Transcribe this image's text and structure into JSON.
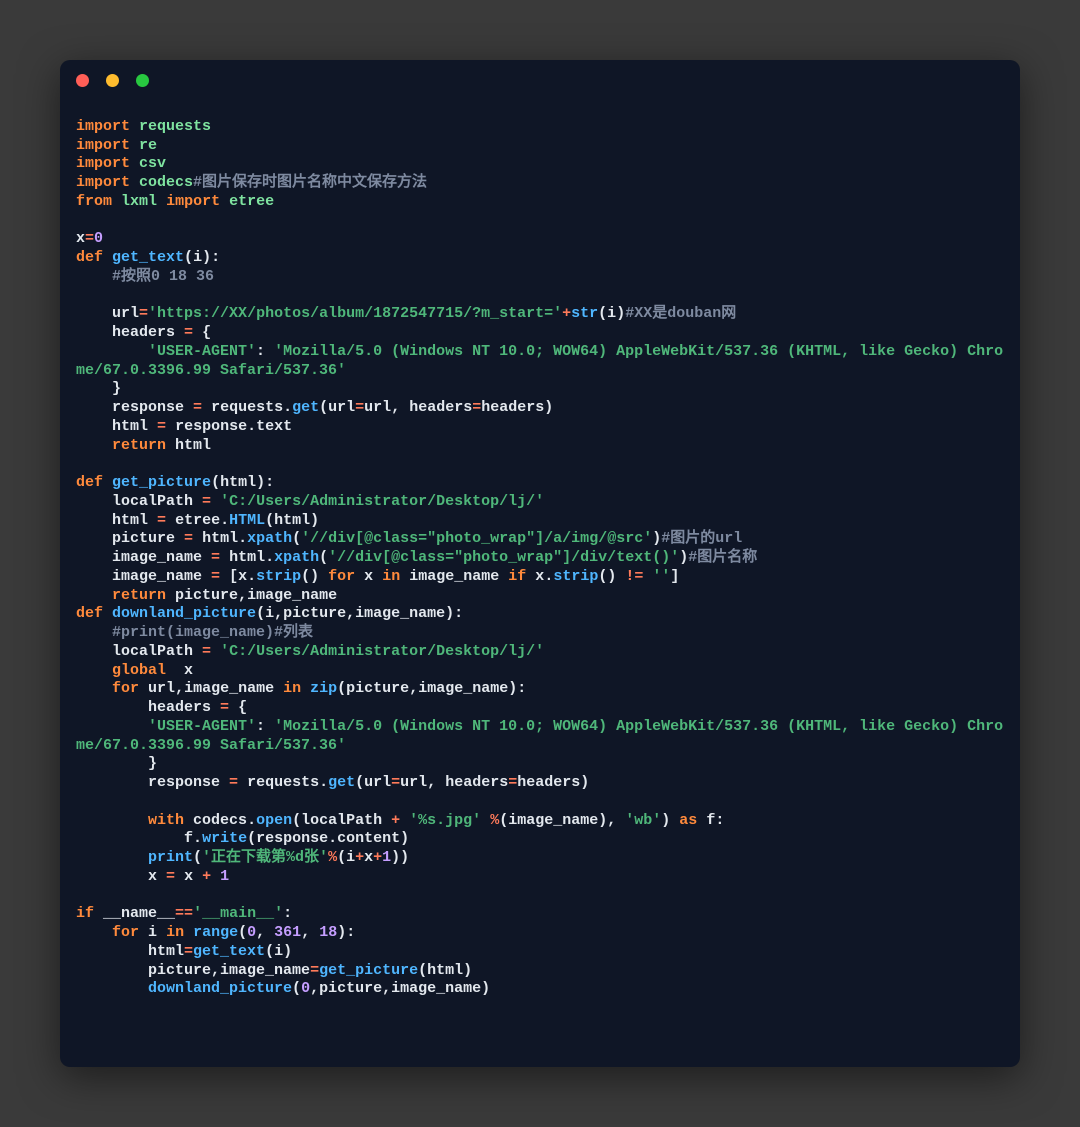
{
  "window": {
    "traffic": [
      "close",
      "minimize",
      "zoom"
    ]
  },
  "code": {
    "lines": [
      [
        [
          "kw",
          "import"
        ],
        [
          "pun",
          " "
        ],
        [
          "name",
          "requests"
        ]
      ],
      [
        [
          "kw",
          "import"
        ],
        [
          "pun",
          " "
        ],
        [
          "name",
          "re"
        ]
      ],
      [
        [
          "kw",
          "import"
        ],
        [
          "pun",
          " "
        ],
        [
          "name",
          "csv"
        ]
      ],
      [
        [
          "kw",
          "import"
        ],
        [
          "pun",
          " "
        ],
        [
          "name",
          "codecs"
        ],
        [
          "cmt",
          "#图片保存时图片名称中文保存方法"
        ]
      ],
      [
        [
          "kw",
          "from"
        ],
        [
          "pun",
          " "
        ],
        [
          "name",
          "lxml"
        ],
        [
          "pun",
          " "
        ],
        [
          "kw",
          "import"
        ],
        [
          "pun",
          " "
        ],
        [
          "name",
          "etree"
        ]
      ],
      [],
      [
        [
          "var",
          "x"
        ],
        [
          "op",
          "="
        ],
        [
          "num",
          "0"
        ]
      ],
      [
        [
          "kw",
          "def"
        ],
        [
          "pun",
          " "
        ],
        [
          "fn",
          "get_text"
        ],
        [
          "pun",
          "("
        ],
        [
          "var",
          "i"
        ],
        [
          "pun",
          "):"
        ]
      ],
      [
        [
          "pun",
          "    "
        ],
        [
          "cmt",
          "#按照0 18 36"
        ]
      ],
      [],
      [
        [
          "pun",
          "    "
        ],
        [
          "var",
          "url"
        ],
        [
          "op",
          "="
        ],
        [
          "str",
          "'https://XX/photos/album/1872547715/?m_start='"
        ],
        [
          "op",
          "+"
        ],
        [
          "fn",
          "str"
        ],
        [
          "pun",
          "("
        ],
        [
          "var",
          "i"
        ],
        [
          "pun",
          ")"
        ],
        [
          "cmt",
          "#XX是douban网"
        ]
      ],
      [
        [
          "pun",
          "    "
        ],
        [
          "var",
          "headers"
        ],
        [
          "pun",
          " "
        ],
        [
          "op",
          "="
        ],
        [
          "pun",
          " {"
        ]
      ],
      [
        [
          "pun",
          "        "
        ],
        [
          "str",
          "'USER-AGENT'"
        ],
        [
          "pun",
          ": "
        ],
        [
          "str",
          "'Mozilla/5.0 (Windows NT 10.0; WOW64) AppleWebKit/537.36 (KHTML, like Gecko) Chrome/67.0.3396.99 Safari/537.36'"
        ]
      ],
      [
        [
          "pun",
          "    }"
        ]
      ],
      [
        [
          "pun",
          "    "
        ],
        [
          "var",
          "response"
        ],
        [
          "pun",
          " "
        ],
        [
          "op",
          "="
        ],
        [
          "pun",
          " "
        ],
        [
          "var",
          "requests"
        ],
        [
          "pun",
          "."
        ],
        [
          "fn",
          "get"
        ],
        [
          "pun",
          "("
        ],
        [
          "var",
          "url"
        ],
        [
          "op",
          "="
        ],
        [
          "var",
          "url"
        ],
        [
          "pun",
          ", "
        ],
        [
          "var",
          "headers"
        ],
        [
          "op",
          "="
        ],
        [
          "var",
          "headers"
        ],
        [
          "pun",
          ")"
        ]
      ],
      [
        [
          "pun",
          "    "
        ],
        [
          "var",
          "html"
        ],
        [
          "pun",
          " "
        ],
        [
          "op",
          "="
        ],
        [
          "pun",
          " "
        ],
        [
          "var",
          "response"
        ],
        [
          "pun",
          "."
        ],
        [
          "attr",
          "text"
        ]
      ],
      [
        [
          "pun",
          "    "
        ],
        [
          "kw",
          "return"
        ],
        [
          "pun",
          " "
        ],
        [
          "var",
          "html"
        ]
      ],
      [],
      [
        [
          "kw",
          "def"
        ],
        [
          "pun",
          " "
        ],
        [
          "fn",
          "get_picture"
        ],
        [
          "pun",
          "("
        ],
        [
          "var",
          "html"
        ],
        [
          "pun",
          "):"
        ]
      ],
      [
        [
          "pun",
          "    "
        ],
        [
          "var",
          "localPath"
        ],
        [
          "pun",
          " "
        ],
        [
          "op",
          "="
        ],
        [
          "pun",
          " "
        ],
        [
          "str",
          "'C:/Users/Administrator/Desktop/lj/'"
        ]
      ],
      [
        [
          "pun",
          "    "
        ],
        [
          "var",
          "html"
        ],
        [
          "pun",
          " "
        ],
        [
          "op",
          "="
        ],
        [
          "pun",
          " "
        ],
        [
          "var",
          "etree"
        ],
        [
          "pun",
          "."
        ],
        [
          "fn",
          "HTML"
        ],
        [
          "pun",
          "("
        ],
        [
          "var",
          "html"
        ],
        [
          "pun",
          ")"
        ]
      ],
      [
        [
          "pun",
          "    "
        ],
        [
          "var",
          "picture"
        ],
        [
          "pun",
          " "
        ],
        [
          "op",
          "="
        ],
        [
          "pun",
          " "
        ],
        [
          "var",
          "html"
        ],
        [
          "pun",
          "."
        ],
        [
          "fn",
          "xpath"
        ],
        [
          "pun",
          "("
        ],
        [
          "str",
          "'//div[@class=\"photo_wrap\"]/a/img/@src'"
        ],
        [
          "pun",
          ")"
        ],
        [
          "cmt",
          "#图片的url"
        ]
      ],
      [
        [
          "pun",
          "    "
        ],
        [
          "var",
          "image_name"
        ],
        [
          "pun",
          " "
        ],
        [
          "op",
          "="
        ],
        [
          "pun",
          " "
        ],
        [
          "var",
          "html"
        ],
        [
          "pun",
          "."
        ],
        [
          "fn",
          "xpath"
        ],
        [
          "pun",
          "("
        ],
        [
          "str",
          "'//div[@class=\"photo_wrap\"]/div/text()'"
        ],
        [
          "pun",
          ")"
        ],
        [
          "cmt",
          "#图片名称"
        ]
      ],
      [
        [
          "pun",
          "    "
        ],
        [
          "var",
          "image_name"
        ],
        [
          "pun",
          " "
        ],
        [
          "op",
          "="
        ],
        [
          "pun",
          " ["
        ],
        [
          "var",
          "x"
        ],
        [
          "pun",
          "."
        ],
        [
          "fn",
          "strip"
        ],
        [
          "pun",
          "() "
        ],
        [
          "kw",
          "for"
        ],
        [
          "pun",
          " "
        ],
        [
          "var",
          "x"
        ],
        [
          "pun",
          " "
        ],
        [
          "kw",
          "in"
        ],
        [
          "pun",
          " "
        ],
        [
          "var",
          "image_name"
        ],
        [
          "pun",
          " "
        ],
        [
          "kw",
          "if"
        ],
        [
          "pun",
          " "
        ],
        [
          "var",
          "x"
        ],
        [
          "pun",
          "."
        ],
        [
          "fn",
          "strip"
        ],
        [
          "pun",
          "() "
        ],
        [
          "op",
          "!="
        ],
        [
          "pun",
          " "
        ],
        [
          "str",
          "''"
        ],
        [
          "pun",
          "]"
        ]
      ],
      [
        [
          "pun",
          "    "
        ],
        [
          "kw",
          "return"
        ],
        [
          "pun",
          " "
        ],
        [
          "var",
          "picture"
        ],
        [
          "pun",
          ","
        ],
        [
          "var",
          "image_name"
        ]
      ],
      [
        [
          "kw",
          "def"
        ],
        [
          "pun",
          " "
        ],
        [
          "fn",
          "downland_picture"
        ],
        [
          "pun",
          "("
        ],
        [
          "var",
          "i"
        ],
        [
          "pun",
          ","
        ],
        [
          "var",
          "picture"
        ],
        [
          "pun",
          ","
        ],
        [
          "var",
          "image_name"
        ],
        [
          "pun",
          "):"
        ]
      ],
      [
        [
          "pun",
          "    "
        ],
        [
          "cmt",
          "#print(image_name)#列表"
        ]
      ],
      [
        [
          "pun",
          "    "
        ],
        [
          "var",
          "localPath"
        ],
        [
          "pun",
          " "
        ],
        [
          "op",
          "="
        ],
        [
          "pun",
          " "
        ],
        [
          "str",
          "'C:/Users/Administrator/Desktop/lj/'"
        ]
      ],
      [
        [
          "pun",
          "    "
        ],
        [
          "kw",
          "global"
        ],
        [
          "pun",
          "  "
        ],
        [
          "var",
          "x"
        ]
      ],
      [
        [
          "pun",
          "    "
        ],
        [
          "kw",
          "for"
        ],
        [
          "pun",
          " "
        ],
        [
          "var",
          "url"
        ],
        [
          "pun",
          ","
        ],
        [
          "var",
          "image_name"
        ],
        [
          "pun",
          " "
        ],
        [
          "kw",
          "in"
        ],
        [
          "pun",
          " "
        ],
        [
          "fn",
          "zip"
        ],
        [
          "pun",
          "("
        ],
        [
          "var",
          "picture"
        ],
        [
          "pun",
          ","
        ],
        [
          "var",
          "image_name"
        ],
        [
          "pun",
          "):"
        ]
      ],
      [
        [
          "pun",
          "        "
        ],
        [
          "var",
          "headers"
        ],
        [
          "pun",
          " "
        ],
        [
          "op",
          "="
        ],
        [
          "pun",
          " {"
        ]
      ],
      [
        [
          "pun",
          "        "
        ],
        [
          "str",
          "'USER-AGENT'"
        ],
        [
          "pun",
          ": "
        ],
        [
          "str",
          "'Mozilla/5.0 (Windows NT 10.0; WOW64) AppleWebKit/537.36 (KHTML, like Gecko) Chrome/67.0.3396.99 Safari/537.36'"
        ]
      ],
      [
        [
          "pun",
          "        }"
        ]
      ],
      [
        [
          "pun",
          "        "
        ],
        [
          "var",
          "response"
        ],
        [
          "pun",
          " "
        ],
        [
          "op",
          "="
        ],
        [
          "pun",
          " "
        ],
        [
          "var",
          "requests"
        ],
        [
          "pun",
          "."
        ],
        [
          "fn",
          "get"
        ],
        [
          "pun",
          "("
        ],
        [
          "var",
          "url"
        ],
        [
          "op",
          "="
        ],
        [
          "var",
          "url"
        ],
        [
          "pun",
          ", "
        ],
        [
          "var",
          "headers"
        ],
        [
          "op",
          "="
        ],
        [
          "var",
          "headers"
        ],
        [
          "pun",
          ")"
        ]
      ],
      [],
      [
        [
          "pun",
          "        "
        ],
        [
          "kw",
          "with"
        ],
        [
          "pun",
          " "
        ],
        [
          "var",
          "codecs"
        ],
        [
          "pun",
          "."
        ],
        [
          "fn",
          "open"
        ],
        [
          "pun",
          "("
        ],
        [
          "var",
          "localPath"
        ],
        [
          "pun",
          " "
        ],
        [
          "op",
          "+"
        ],
        [
          "pun",
          " "
        ],
        [
          "str",
          "'%s.jpg'"
        ],
        [
          "pun",
          " "
        ],
        [
          "op",
          "%"
        ],
        [
          "pun",
          "("
        ],
        [
          "var",
          "image_name"
        ],
        [
          "pun",
          "), "
        ],
        [
          "str",
          "'wb'"
        ],
        [
          "pun",
          ") "
        ],
        [
          "kw",
          "as"
        ],
        [
          "pun",
          " "
        ],
        [
          "var",
          "f"
        ],
        [
          "pun",
          ":"
        ]
      ],
      [
        [
          "pun",
          "            "
        ],
        [
          "var",
          "f"
        ],
        [
          "pun",
          "."
        ],
        [
          "fn",
          "write"
        ],
        [
          "pun",
          "("
        ],
        [
          "var",
          "response"
        ],
        [
          "pun",
          "."
        ],
        [
          "attr",
          "content"
        ],
        [
          "pun",
          ")"
        ]
      ],
      [
        [
          "pun",
          "        "
        ],
        [
          "fn",
          "print"
        ],
        [
          "pun",
          "("
        ],
        [
          "str",
          "'正在下载第%d张'"
        ],
        [
          "op",
          "%"
        ],
        [
          "pun",
          "("
        ],
        [
          "var",
          "i"
        ],
        [
          "op",
          "+"
        ],
        [
          "var",
          "x"
        ],
        [
          "op",
          "+"
        ],
        [
          "num",
          "1"
        ],
        [
          "pun",
          "))"
        ]
      ],
      [
        [
          "pun",
          "        "
        ],
        [
          "var",
          "x"
        ],
        [
          "pun",
          " "
        ],
        [
          "op",
          "="
        ],
        [
          "pun",
          " "
        ],
        [
          "var",
          "x"
        ],
        [
          "pun",
          " "
        ],
        [
          "op",
          "+"
        ],
        [
          "pun",
          " "
        ],
        [
          "num",
          "1"
        ]
      ],
      [],
      [
        [
          "kw",
          "if"
        ],
        [
          "pun",
          " "
        ],
        [
          "var",
          "__name__"
        ],
        [
          "op",
          "=="
        ],
        [
          "str",
          "'__main__'"
        ],
        [
          "pun",
          ":"
        ]
      ],
      [
        [
          "pun",
          "    "
        ],
        [
          "kw",
          "for"
        ],
        [
          "pun",
          " "
        ],
        [
          "var",
          "i"
        ],
        [
          "pun",
          " "
        ],
        [
          "kw",
          "in"
        ],
        [
          "pun",
          " "
        ],
        [
          "fn",
          "range"
        ],
        [
          "pun",
          "("
        ],
        [
          "num",
          "0"
        ],
        [
          "pun",
          ", "
        ],
        [
          "num",
          "361"
        ],
        [
          "pun",
          ", "
        ],
        [
          "num",
          "18"
        ],
        [
          "pun",
          "):"
        ]
      ],
      [
        [
          "pun",
          "        "
        ],
        [
          "var",
          "html"
        ],
        [
          "op",
          "="
        ],
        [
          "fn",
          "get_text"
        ],
        [
          "pun",
          "("
        ],
        [
          "var",
          "i"
        ],
        [
          "pun",
          ")"
        ]
      ],
      [
        [
          "pun",
          "        "
        ],
        [
          "var",
          "picture"
        ],
        [
          "pun",
          ","
        ],
        [
          "var",
          "image_name"
        ],
        [
          "op",
          "="
        ],
        [
          "fn",
          "get_picture"
        ],
        [
          "pun",
          "("
        ],
        [
          "var",
          "html"
        ],
        [
          "pun",
          ")"
        ]
      ],
      [
        [
          "pun",
          "        "
        ],
        [
          "fn",
          "downland_picture"
        ],
        [
          "pun",
          "("
        ],
        [
          "num",
          "0"
        ],
        [
          "pun",
          ","
        ],
        [
          "var",
          "picture"
        ],
        [
          "pun",
          ","
        ],
        [
          "var",
          "image_name"
        ],
        [
          "pun",
          ")"
        ]
      ]
    ]
  }
}
